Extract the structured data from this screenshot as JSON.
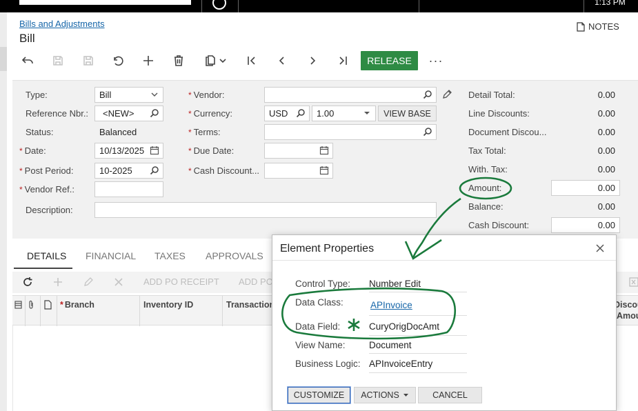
{
  "header": {
    "clock": "1:13 PM",
    "breadcrumb": "Bills and Adjustments",
    "title": "Bill",
    "notes_label": "NOTES"
  },
  "toolbar": {
    "release_label": "RELEASE",
    "more_label": "···"
  },
  "form": {
    "type_label": "Type:",
    "type_value": "Bill",
    "refnbr_label": "Reference Nbr.:",
    "refnbr_value": "<NEW>",
    "status_label": "Status:",
    "status_value": "Balanced",
    "date_label": "Date:",
    "date_value": "10/13/2025",
    "postperiod_label": "Post Period:",
    "postperiod_value": "10-2025",
    "vendorref_label": "Vendor Ref.:",
    "vendorref_value": "",
    "description_label": "Description:",
    "description_value": "",
    "vendor_label": "Vendor:",
    "vendor_value": "",
    "currency_label": "Currency:",
    "currency_value": "USD",
    "rate_value": "1.00",
    "viewbase_label": "VIEW BASE",
    "terms_label": "Terms:",
    "terms_value": "",
    "duedate_label": "Due Date:",
    "duedate_value": "",
    "cashdisc_label": "Cash Discount...",
    "cashdisc_value": ""
  },
  "totals": {
    "detail_total_label": "Detail Total:",
    "detail_total": "0.00",
    "line_disc_label": "Line Discounts:",
    "line_disc": "0.00",
    "doc_disc_label": "Document Discou...",
    "doc_disc": "0.00",
    "tax_total_label": "Tax Total:",
    "tax_total": "0.00",
    "with_tax_label": "With. Tax:",
    "with_tax": "0.00",
    "amount_label": "Amount:",
    "amount": "0.00",
    "balance_label": "Balance:",
    "balance": "0.00",
    "cash_discount_label": "Cash Discount:",
    "cash_discount": "0.00"
  },
  "tabs": [
    "DETAILS",
    "FINANCIAL",
    "TAXES",
    "APPROVALS"
  ],
  "grid_toolbar": {
    "add_po_receipt": "ADD PO RECEIPT",
    "add_po": "ADD PO"
  },
  "grid_columns": [
    "Branch",
    "Inventory ID",
    "Transaction",
    "Discou",
    "Amou"
  ],
  "dialog": {
    "title": "Element Properties",
    "control_type_label": "Control Type:",
    "control_type": "Number Edit",
    "data_class_label": "Data Class:",
    "data_class": "APInvoice",
    "data_field_label": "Data Field:",
    "data_field": "CuryOrigDocAmt",
    "view_name_label": "View Name:",
    "view_name": "Document",
    "business_logic_label": "Business Logic:",
    "business_logic": "APInvoiceEntry",
    "customize_label": "CUSTOMIZE",
    "actions_label": "ACTIONS",
    "cancel_label": "CANCEL"
  },
  "colors": {
    "accent_green": "#2e8b44",
    "link_blue": "#1565a8",
    "annotation_green": "#1a7a3c"
  }
}
